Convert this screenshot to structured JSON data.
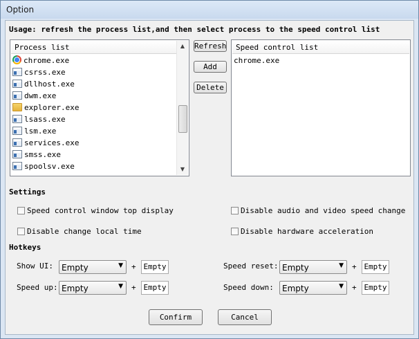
{
  "window": {
    "title": "Option"
  },
  "usage_text": "Usage: refresh the process list,and then select process to the speed control list",
  "process_list": {
    "header": "Process list",
    "items": [
      {
        "name": "chrome.exe",
        "icon": "chrome-icon"
      },
      {
        "name": "csrss.exe",
        "icon": "exe-icon"
      },
      {
        "name": "dllhost.exe",
        "icon": "exe-icon"
      },
      {
        "name": "dwm.exe",
        "icon": "exe-icon"
      },
      {
        "name": "explorer.exe",
        "icon": "folder-icon"
      },
      {
        "name": "lsass.exe",
        "icon": "exe-icon"
      },
      {
        "name": "lsm.exe",
        "icon": "exe-icon"
      },
      {
        "name": "services.exe",
        "icon": "exe-icon"
      },
      {
        "name": "smss.exe",
        "icon": "exe-icon"
      },
      {
        "name": "spoolsv.exe",
        "icon": "exe-icon"
      }
    ]
  },
  "buttons": {
    "refresh": "Refresh",
    "add": "Add",
    "delete": "Delete",
    "confirm": "Confirm",
    "cancel": "Cancel"
  },
  "speed_list": {
    "header": "Speed control list",
    "items": [
      "chrome.exe"
    ]
  },
  "settings": {
    "heading": "Settings",
    "options": [
      {
        "label": "Speed control window top display",
        "checked": false
      },
      {
        "label": "Disable audio and video speed change",
        "checked": false
      },
      {
        "label": "Disable change local time",
        "checked": false
      },
      {
        "label": "Disable hardware acceleration",
        "checked": false
      }
    ]
  },
  "hotkeys": {
    "heading": "Hotkeys",
    "plus": "+",
    "rows": [
      {
        "label": "Show UI:",
        "modifier": "Empty",
        "key": "Empty"
      },
      {
        "label": "Speed reset:",
        "modifier": "Empty",
        "key": "Empty"
      },
      {
        "label": "Speed up:",
        "modifier": "Empty",
        "key": "Empty"
      },
      {
        "label": "Speed down:",
        "modifier": "Empty",
        "key": "Empty"
      }
    ]
  }
}
